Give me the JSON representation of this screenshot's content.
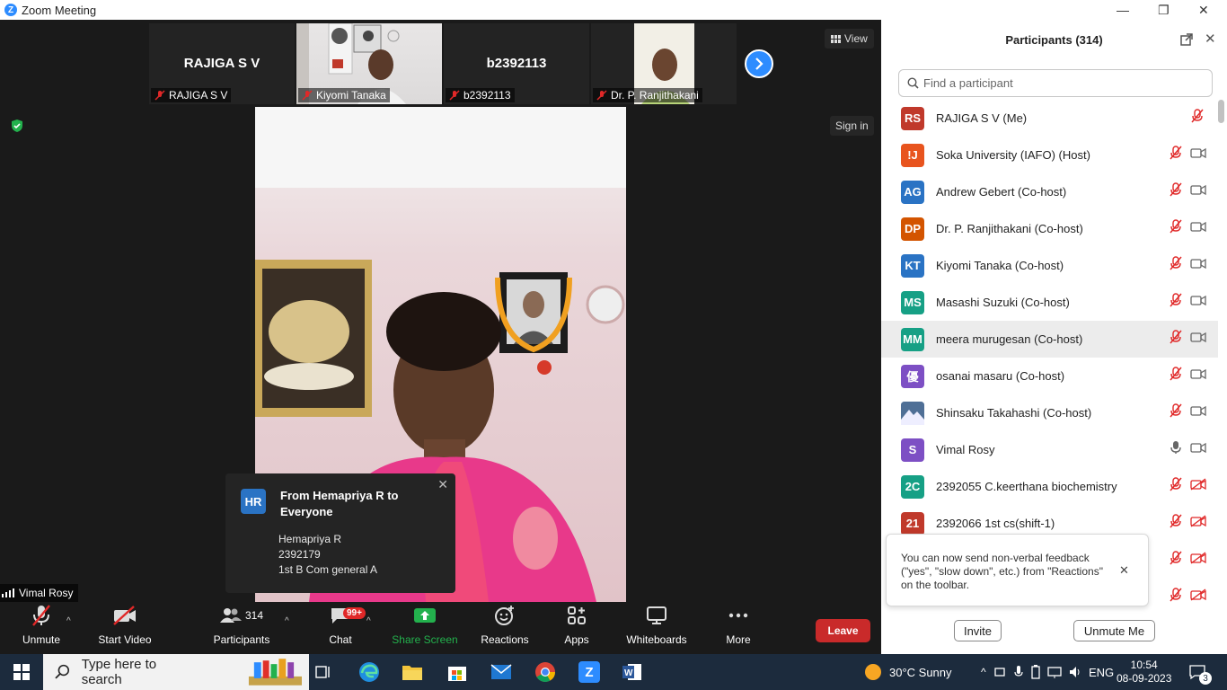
{
  "window": {
    "title": "Zoom Meeting"
  },
  "thumbnails": [
    {
      "big_name": "RAJIGA S V",
      "label": "RAJIGA S V",
      "video": false
    },
    {
      "big_name": "",
      "label": "Kiyomi Tanaka",
      "video": true
    },
    {
      "big_name": "b2392113",
      "label": "b2392113",
      "video": false
    },
    {
      "big_name": "",
      "label": "Dr. P. Ranjithakani",
      "video": true
    }
  ],
  "view_label": "View",
  "signin_label": "Sign in",
  "chat_popup": {
    "initials": "HR",
    "from": "From Hemapriya R to Everyone",
    "lines": [
      "Hemapriya R",
      "2392179",
      "1st B Com general A"
    ]
  },
  "active_speaker": "Vimal Rosy",
  "toolbar": {
    "unmute": "Unmute",
    "start_video": "Start Video",
    "participants": "Participants",
    "participants_count": "314",
    "chat": "Chat",
    "chat_badge": "99+",
    "share_screen": "Share Screen",
    "reactions": "Reactions",
    "apps": "Apps",
    "whiteboards": "Whiteboards",
    "more": "More",
    "leave": "Leave"
  },
  "panel": {
    "title": "Participants (314)",
    "search_placeholder": "Find a participant",
    "participants": [
      {
        "initials": "RS",
        "color": "#c0392b",
        "name": "RAJIGA S V (Me)",
        "mic": "muted",
        "cam": "none"
      },
      {
        "initials": "!J",
        "color": "#e8541e",
        "name": "Soka University (IAFO) (Host)",
        "mic": "muted",
        "cam": "on"
      },
      {
        "initials": "AG",
        "color": "#2a73c4",
        "name": "Andrew Gebert (Co-host)",
        "mic": "muted",
        "cam": "on"
      },
      {
        "initials": "DP",
        "color": "#d35400",
        "name": "Dr. P. Ranjithakani (Co-host)",
        "mic": "muted",
        "cam": "on"
      },
      {
        "initials": "KT",
        "color": "#2a73c4",
        "name": "Kiyomi Tanaka (Co-host)",
        "mic": "muted",
        "cam": "on"
      },
      {
        "initials": "MS",
        "color": "#16a085",
        "name": "Masashi Suzuki (Co-host)",
        "mic": "muted",
        "cam": "on"
      },
      {
        "initials": "MM",
        "color": "#16a085",
        "name": "meera murugesan (Co-host)",
        "mic": "muted",
        "cam": "on"
      },
      {
        "initials": "優",
        "color": "#7d4fc4",
        "name": "osanai masaru (Co-host)",
        "mic": "muted",
        "cam": "on"
      },
      {
        "initials": "",
        "color": "#5a7fa8",
        "name": "Shinsaku Takahashi (Co-host)",
        "mic": "muted",
        "cam": "on"
      },
      {
        "initials": "S",
        "color": "#7d4fc4",
        "name": "Vimal Rosy",
        "mic": "on",
        "cam": "on"
      },
      {
        "initials": "2C",
        "color": "#16a085",
        "name": "2392055  C.keerthana  biochemistry",
        "mic": "muted",
        "cam": "off"
      },
      {
        "initials": "21",
        "color": "#c0392b",
        "name": "2392066 1st cs(shift-1)",
        "mic": "muted",
        "cam": "off"
      },
      {
        "initials": "",
        "color": "#ffffff",
        "name": "",
        "mic": "muted",
        "cam": "off"
      },
      {
        "initials": "",
        "color": "#ffffff",
        "name": "",
        "mic": "muted",
        "cam": "off"
      }
    ],
    "tip": "You can now send non-verbal feedback (\"yes\", \"slow down\", etc.) from \"Reactions\" on the toolbar.",
    "invite": "Invite",
    "unmute_me": "Unmute Me"
  },
  "taskbar": {
    "search_placeholder": "Type here to search",
    "weather": "30°C  Sunny",
    "lang": "ENG",
    "time": "10:54",
    "date": "08-09-2023",
    "notifications": "3"
  },
  "colors": {
    "zoom_blue": "#2d8cff",
    "leave_red": "#c92a2a",
    "share_green": "#23b14d",
    "muted_red": "#e02828"
  }
}
